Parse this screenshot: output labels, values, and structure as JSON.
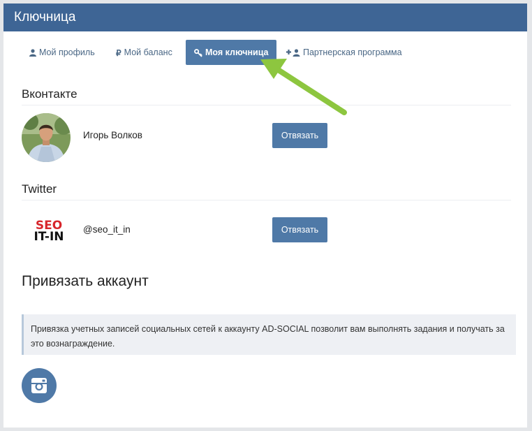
{
  "header": {
    "title": "Ключница"
  },
  "tabs": [
    {
      "label": "Мой профиль",
      "icon": "user-icon"
    },
    {
      "label": "Мой баланс",
      "icon": "ruble-icon"
    },
    {
      "label": "Моя ключница",
      "icon": "key-icon",
      "active": true
    },
    {
      "label": "Партнерская программа",
      "icon": "add-user-icon"
    }
  ],
  "accounts": {
    "vk": {
      "section": "Вконтакте",
      "name": "Игорь Волков",
      "button": "Отвязать"
    },
    "twitter": {
      "section": "Twitter",
      "name": "@seo_it_in",
      "button": "Отвязать",
      "logo_line1": "SEO",
      "logo_line2": "IT-IN"
    }
  },
  "bind": {
    "title": "Привязать аккаунт",
    "info": "Привязка учетных записей социальных сетей к аккаунту AD-SOCIAL позволит вам выполнять задания и получать за это вознаграждение.",
    "networks": [
      {
        "icon": "instagram-icon"
      }
    ]
  },
  "colors": {
    "header": "#3e6595",
    "accent": "#4f79a7",
    "arrow": "#8dc63f",
    "logo_red": "#d7262c"
  }
}
